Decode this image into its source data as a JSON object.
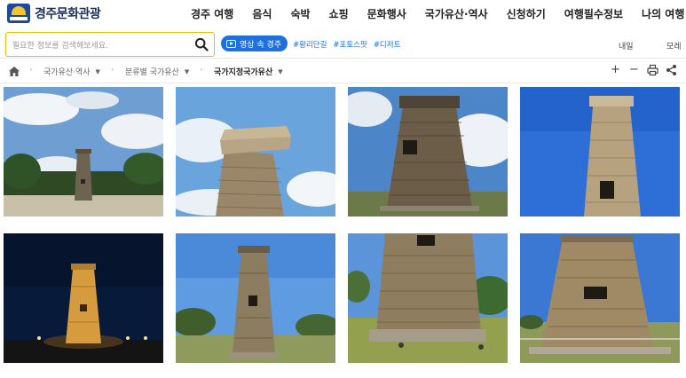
{
  "site": {
    "title": "경주문화관광",
    "logo_icon": "city-emblem-icon"
  },
  "nav": {
    "items": [
      "경주 여행",
      "음식",
      "숙박",
      "쇼핑",
      "문화행사",
      "국가유산·역사",
      "신청하기",
      "여행필수정보",
      "나의 여행"
    ]
  },
  "search": {
    "placeholder": "필요한 정보를 검색해보세요.",
    "icon": "search-icon"
  },
  "video_button": {
    "label": "영상 속 경주",
    "icon": "video-icon"
  },
  "hashtags": [
    "#황리단길",
    "#포토스팟",
    "#디저트"
  ],
  "weather": {
    "tomorrow": "내일",
    "day_after": "모레"
  },
  "breadcrumb": {
    "items": [
      "국가유산·역사",
      "분류별 국가유산",
      "국가지정국가유산"
    ]
  },
  "tools": {
    "zoom_in": "+",
    "zoom_out": "−"
  },
  "gallery": {
    "images": [
      {
        "name": "cheomseongdae-cloudy-sky-photo"
      },
      {
        "name": "cheomseongdae-top-closeup-photo"
      },
      {
        "name": "cheomseongdae-lowangle-clouds-photo"
      },
      {
        "name": "cheomseongdae-blue-sky-photo"
      },
      {
        "name": "cheomseongdae-night-lights-photo"
      },
      {
        "name": "cheomseongdae-park-photo"
      },
      {
        "name": "cheomseongdae-lawn-closeup-photo"
      },
      {
        "name": "cheomseongdae-fence-photo"
      }
    ]
  },
  "colors": {
    "accent": "#1e6fe0",
    "search_border": "#f2b705",
    "logo": "#1b2d5a"
  }
}
